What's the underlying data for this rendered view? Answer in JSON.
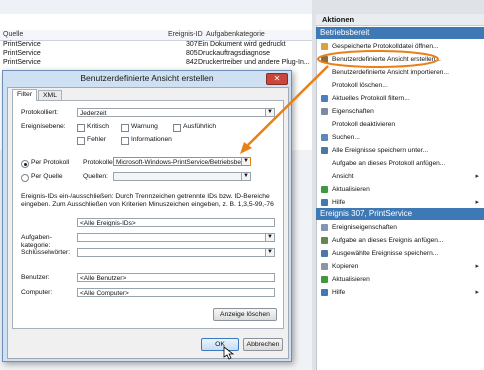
{
  "background": {
    "columns": [
      "Quelle",
      "Ereignis-ID",
      "Aufgabenkategorie"
    ],
    "rows": [
      {
        "source": "PrintService",
        "id": "307",
        "category": "Ein Dokument wird gedruckt"
      },
      {
        "source": "PrintService",
        "id": "805",
        "category": "Druckauftragsdiagnose"
      },
      {
        "source": "PrintService",
        "id": "842",
        "category": "Druckertreiber und andere Plug-In..."
      }
    ]
  },
  "actions": {
    "title": "Aktionen",
    "section1": "Betriebsbereit",
    "items1": [
      {
        "label": "Gespeicherte Protokolldatei öffnen...",
        "icon": "folder-icon",
        "color": "#d9a23a"
      },
      {
        "label": "Benutzerdefinierte Ansicht erstellen...",
        "icon": "filter-icon",
        "color": "#8a6d3b"
      },
      {
        "label": "Benutzerdefinierte Ansicht importieren...",
        "icon": "",
        "color": ""
      },
      {
        "label": "Protokoll löschen...",
        "icon": "",
        "color": ""
      },
      {
        "label": "Aktuelles Protokoll filtern...",
        "icon": "filter-icon",
        "color": "#4a7fbf"
      },
      {
        "label": "Eigenschaften",
        "icon": "properties-icon",
        "color": "#7a8aa0"
      },
      {
        "label": "Protokoll deaktivieren",
        "icon": "",
        "color": ""
      },
      {
        "label": "Suchen...",
        "icon": "search-icon",
        "color": "#5d87b8"
      },
      {
        "label": "Alle Ereignisse speichern unter...",
        "icon": "save-icon",
        "color": "#4d77a8"
      },
      {
        "label": "Aufgabe an dieses Protokoll anfügen...",
        "icon": "",
        "color": ""
      },
      {
        "label": "Ansicht",
        "icon": "",
        "color": "",
        "submenu": true
      },
      {
        "label": "Aktualisieren",
        "icon": "refresh-icon",
        "color": "#3f9a3f"
      },
      {
        "label": "Hilfe",
        "icon": "help-icon",
        "color": "#3e79b5",
        "submenu": true
      }
    ],
    "section2": "Ereignis 307, PrintService",
    "items2": [
      {
        "label": "Ereigniseigenschaften",
        "icon": "event-icon",
        "color": "#8096b4"
      },
      {
        "label": "Aufgabe an dieses Ereignis anfügen...",
        "icon": "task-icon",
        "color": "#5f8a4a"
      },
      {
        "label": "Ausgewählte Ereignisse speichern...",
        "icon": "save-icon",
        "color": "#4d77a8"
      },
      {
        "label": "Kopieren",
        "icon": "copy-icon",
        "color": "#8c95a2",
        "submenu": true
      },
      {
        "label": "Aktualisieren",
        "icon": "refresh-icon",
        "color": "#3f9a3f"
      },
      {
        "label": "Hilfe",
        "icon": "help-icon",
        "color": "#3e79b5",
        "submenu": true
      }
    ]
  },
  "dialog": {
    "title": "Benutzerdefinierte Ansicht erstellen",
    "close": "✕",
    "tabs": [
      "Filter",
      "XML"
    ],
    "logged_label": "Protokolliert:",
    "logged_value": "Jederzeit",
    "level_label": "Ereignisebene:",
    "levels": [
      "Kritisch",
      "Warnung",
      "Ausführlich",
      "Fehler",
      "Informationen"
    ],
    "by_log_label": "Per Protokoll",
    "logs_label": "Protokolle:",
    "logs_value": "Microsoft-Windows-PrintService/Betriebsbereit",
    "by_source_label": "Per Quelle",
    "sources_label": "Quellen:",
    "hint": "Ereignis-IDs ein-/ausschließen: Durch Trennzeichen getrennte IDs bzw. ID-Bereiche eingeben. Zum Ausschließen von Kriterien Minuszeichen eingeben, z. B. 1,3,5-99,-76",
    "ids_value": "<Alle Ereignis-IDs>",
    "task_label": "Aufgaben-\nkategorie:",
    "keywords_label": "Schlüsselwörter:",
    "user_label": "Benutzer:",
    "user_value": "<Alle Benutzer>",
    "computer_label": "Computer:",
    "computer_value": "<Alle Computer>",
    "clear_label": "Anzeige löschen",
    "ok_label": "OK",
    "cancel_label": "Abbrechen"
  },
  "colors": {
    "accent": "#3e79b5",
    "annotation": "#e8801a"
  }
}
